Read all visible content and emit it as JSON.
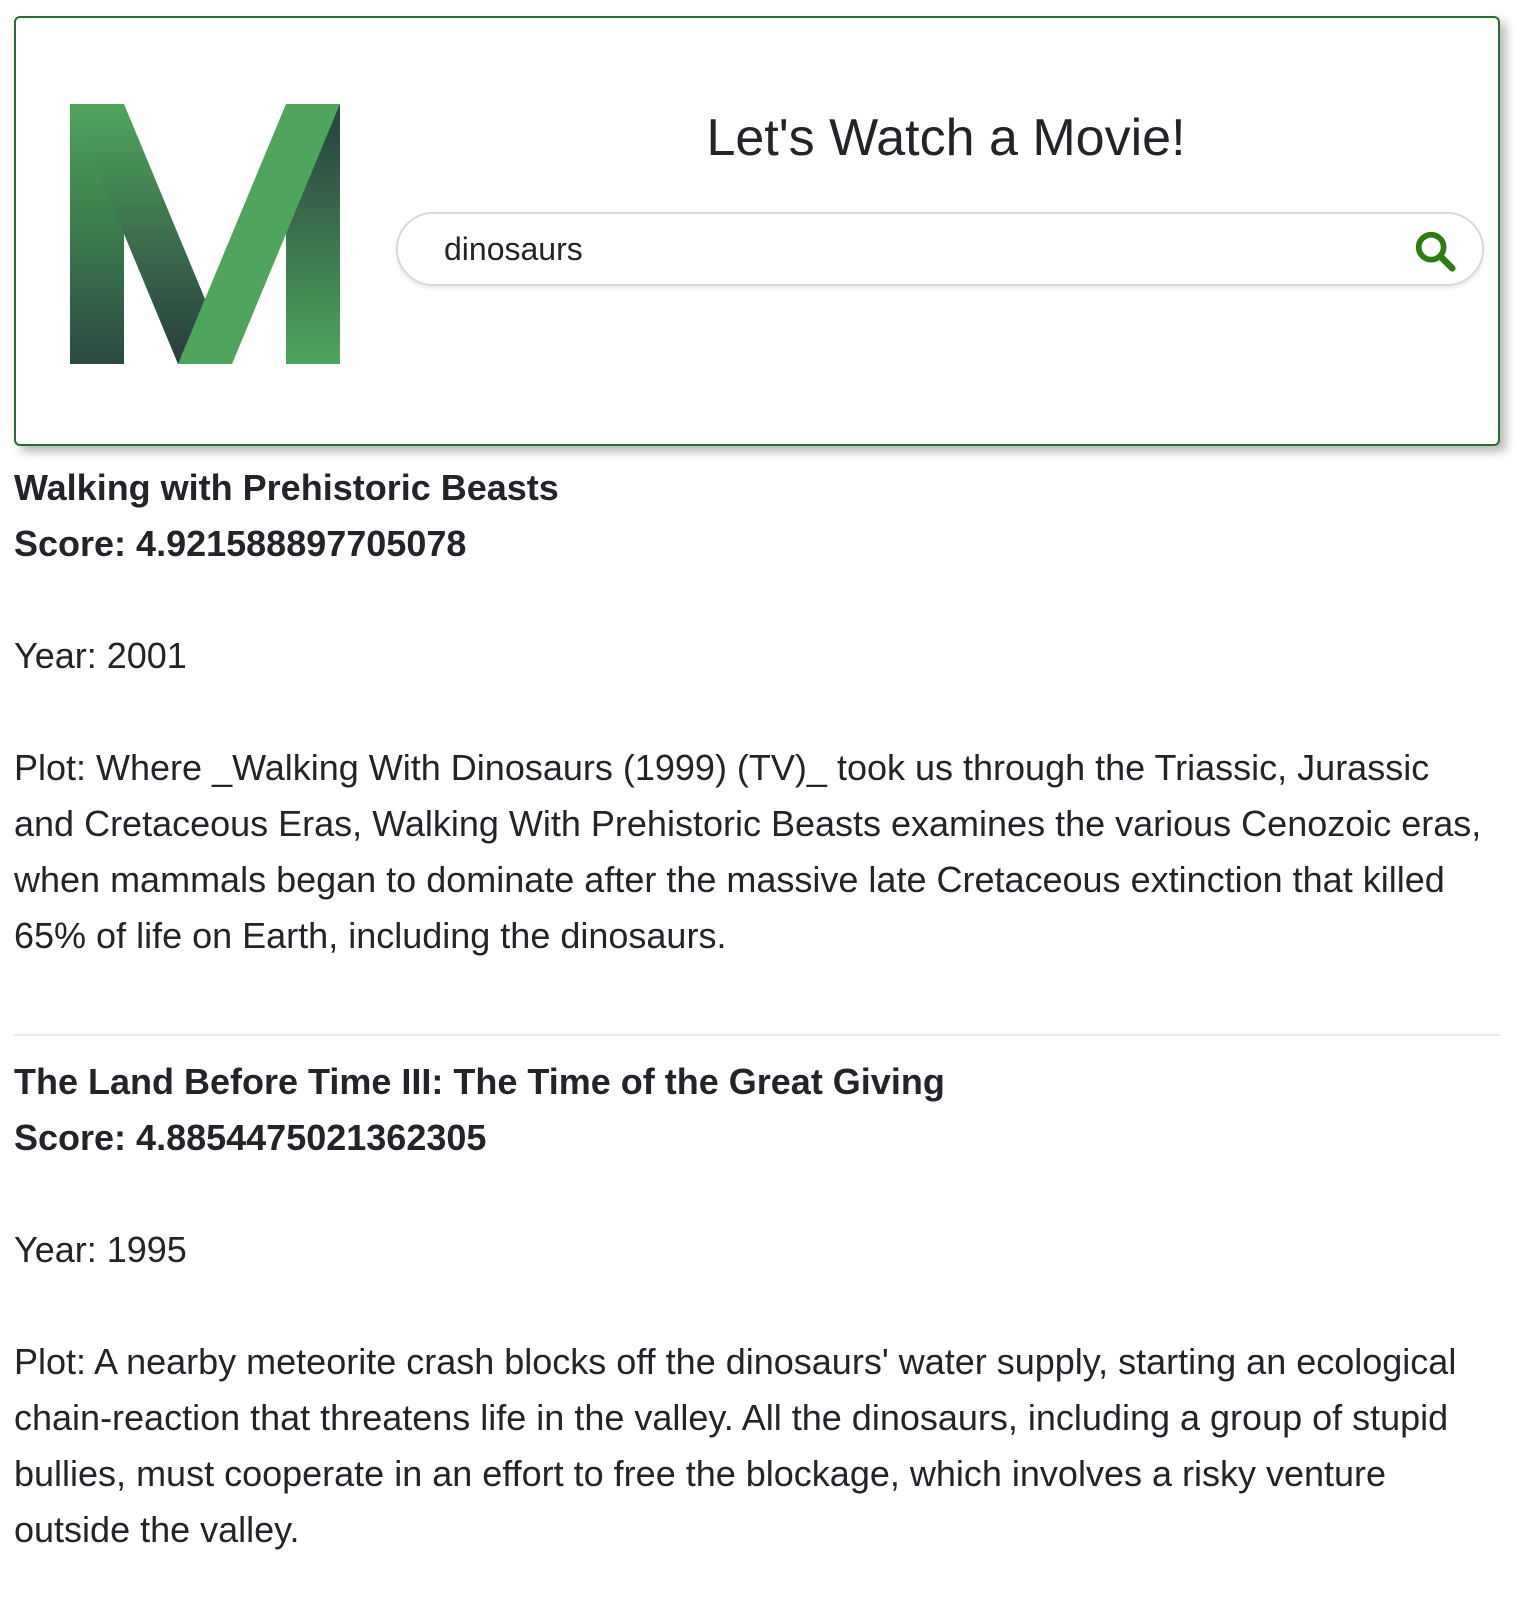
{
  "header": {
    "logo_letter": "M",
    "title": "Let's Watch a Movie!",
    "accent_color": "#4fa55c",
    "accent_dark": "#283e3e",
    "border_color": "#2c6b2f"
  },
  "search": {
    "value": "dinosaurs",
    "icon": "search-icon",
    "icon_color": "#2f7d12"
  },
  "results": [
    {
      "title": "Walking with Prehistoric Beasts",
      "score": "Score: 4.921588897705078",
      "year": "Year: 2001",
      "plot": "Plot: Where _Walking With Dinosaurs (1999) (TV)_ took us through the Triassic, Jurassic and Cretaceous Eras, Walking With Prehistoric Beasts examines the various Cenozoic eras, when mammals began to dominate after the massive late Cretaceous extinction that killed 65% of life on Earth, including the dinosaurs."
    },
    {
      "title": "The Land Before Time III: The Time of the Great Giving",
      "score": "Score: 4.8854475021362305",
      "year": "Year: 1995",
      "plot": "Plot: A nearby meteorite crash blocks off the dinosaurs' water supply, starting an ecological chain-reaction that threatens life in the valley. All the dinosaurs, including a group of stupid bullies, must cooperate in an effort to free the blockage, which involves a risky venture outside the valley."
    }
  ]
}
